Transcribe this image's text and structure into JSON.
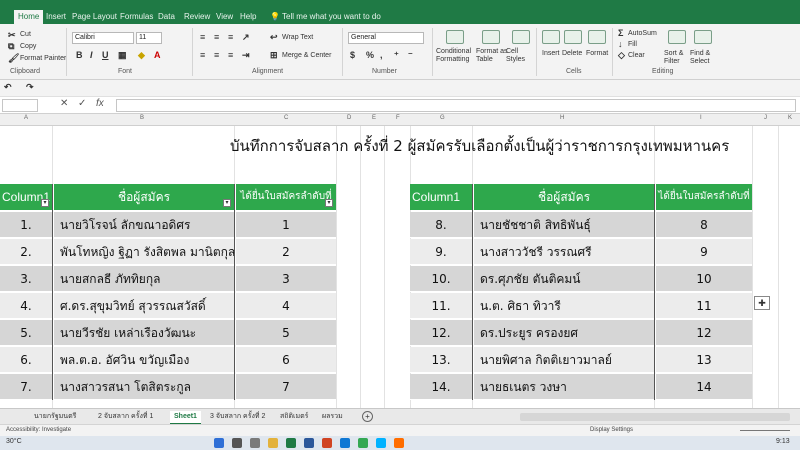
{
  "ribbon_tabs": [
    "Home",
    "Insert",
    "Page Layout",
    "Formulas",
    "Data",
    "Review",
    "View",
    "Help"
  ],
  "tell_me": "Tell me what you want to do",
  "clipboard": {
    "cut": "Cut",
    "copy": "Copy",
    "format_painter": "Format Painter",
    "label": "Clipboard"
  },
  "font": {
    "name": "Calibri",
    "size": "11",
    "label": "Font"
  },
  "alignment": {
    "wrap_text": "Wrap Text",
    "merge_center": "Merge & Center",
    "label": "Alignment"
  },
  "number": {
    "format": "General",
    "label": "Number"
  },
  "styles": {
    "conditional": "Conditional Formatting",
    "format_table": "Format as Table",
    "cell_styles": "Cell Styles"
  },
  "cells": {
    "insert": "Insert",
    "delete": "Delete",
    "format": "Format",
    "label": "Cells"
  },
  "editing": {
    "autosum": "AutoSum",
    "fill": "Fill",
    "clear": "Clear",
    "sort": "Sort & Filter",
    "find": "Find & Select",
    "label": "Editing"
  },
  "formula_bar": {
    "fx": "fx"
  },
  "column_letters": [
    "A",
    "B",
    "C",
    "D",
    "E",
    "F",
    "G",
    "H",
    "I",
    "J",
    "K"
  ],
  "sheet_title": "บันทึกการจับสลาก  ครั้งที่ 2 ผู้สมัครรับเลือกตั้งเป็นผู้ว่าราชการกรุงเทพมหานคร",
  "headers": {
    "column1": "Column1",
    "name": "ชื่อผู้สมัคร",
    "number": "ได้ยื่นใบสมัครลำดับที่"
  },
  "left_rows": [
    {
      "idx": "1.",
      "name": "นายวิโรจน์  ลักขณาอดิศร",
      "num": "1"
    },
    {
      "idx": "2.",
      "name": "พันโทหญิง ฐิฏา รังสิตพล มานิตกุล",
      "num": "2"
    },
    {
      "idx": "3.",
      "name": "นายสกลธี  ภัททิยกุล",
      "num": "3"
    },
    {
      "idx": "4.",
      "name": "ศ.ดร.สุขุมวิทย์  สุวรรณสวัสดิ์",
      "num": "4"
    },
    {
      "idx": "5.",
      "name": "นายวีรชัย เหล่าเรืองวัฒนะ",
      "num": "5"
    },
    {
      "idx": "6.",
      "name": "พล.ต.อ. อัศวิน  ขวัญเมือง",
      "num": "6"
    },
    {
      "idx": "7.",
      "name": "นางสาวรสนา  โตสิตระกูล",
      "num": "7"
    }
  ],
  "right_rows": [
    {
      "idx": "8.",
      "name": "นายชัชชาติ  สิทธิพันธุ์",
      "num": "8"
    },
    {
      "idx": "9.",
      "name": "นางสาววัชรี  วรรณศรี",
      "num": "9"
    },
    {
      "idx": "10.",
      "name": "ดร.ศุภชัย  ตันติคมน์",
      "num": "10"
    },
    {
      "idx": "11.",
      "name": "น.ต. ศิธา  ทิวารี",
      "num": "11"
    },
    {
      "idx": "12.",
      "name": "ดร.ประยูร  ครองยศ",
      "num": "12"
    },
    {
      "idx": "13.",
      "name": "นายพิศาล  กิตติเยาวมาลย์",
      "num": "13"
    },
    {
      "idx": "14.",
      "name": "นายธเนตร  วงษา",
      "num": "14"
    }
  ],
  "sheet_tabs": [
    "นายกรัฐมนตรี",
    "2 จับสลาก ครั้งที่ 1",
    "Sheet1",
    "3 จับสลาก ครั้งที่ 2",
    "สถิติเมตร์",
    "ผลรวม"
  ],
  "active_sheet": "Sheet1",
  "status": {
    "accessibility": "Accessibility: Investigate",
    "display_settings": "Display Settings"
  },
  "taskbar": {
    "temp": "30°C",
    "time": "9:13"
  },
  "colors": {
    "brand": "#1f7a45",
    "header_green": "#2ea84c",
    "row_grey": "#d6d6d6"
  }
}
